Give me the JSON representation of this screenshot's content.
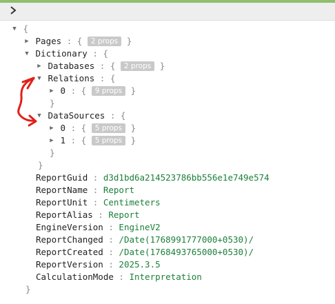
{
  "header": {
    "toggle_icon": "chevron-right-icon"
  },
  "tree": {
    "open_brace": "{",
    "close_brace": "}",
    "pages": {
      "key": "Pages",
      "badge": "2 props"
    },
    "dictionary": {
      "key": "Dictionary",
      "databases": {
        "key": "Databases",
        "badge": "2 props"
      },
      "relations": {
        "key": "Relations",
        "items": [
          {
            "key": "0",
            "badge": "9 props"
          }
        ]
      },
      "datasources": {
        "key": "DataSources",
        "items": [
          {
            "key": "0",
            "badge": "5 props"
          },
          {
            "key": "1",
            "badge": "5 props"
          }
        ]
      }
    },
    "props": [
      {
        "key": "ReportGuid",
        "value": "d3d1bd6a214523786bb556e1e749e574"
      },
      {
        "key": "ReportName",
        "value": "Report"
      },
      {
        "key": "ReportUnit",
        "value": "Centimeters"
      },
      {
        "key": "ReportAlias",
        "value": "Report"
      },
      {
        "key": "EngineVersion",
        "value": "EngineV2"
      },
      {
        "key": "ReportChanged",
        "value": "/Date(1768991777000+0530)/"
      },
      {
        "key": "ReportCreated",
        "value": "/Date(1768493765000+0530)/"
      },
      {
        "key": "ReportVersion",
        "value": "2025.3.5"
      },
      {
        "key": "CalculationMode",
        "value": "Interpretation"
      }
    ]
  },
  "colors": {
    "value_green": "#1b7f3a",
    "annotation_red": "#e0201a",
    "badge_gray": "#c9c9c9"
  }
}
